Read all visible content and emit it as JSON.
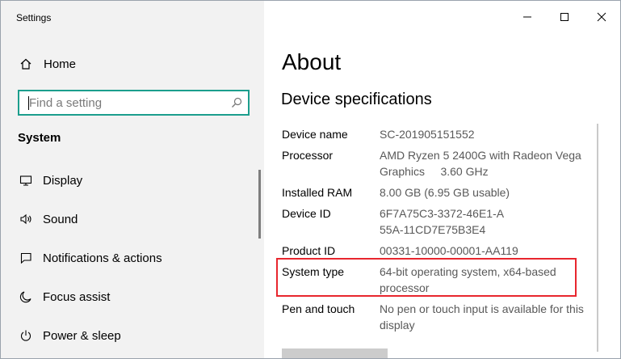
{
  "window": {
    "title": "Settings"
  },
  "sidebar": {
    "home_label": "Home",
    "search": {
      "placeholder": "Find a setting"
    },
    "section_title": "System",
    "items": [
      {
        "label": "Display",
        "icon": "display-icon"
      },
      {
        "label": "Sound",
        "icon": "speaker-icon"
      },
      {
        "label": "Notifications & actions",
        "icon": "notifications-icon"
      },
      {
        "label": "Focus assist",
        "icon": "moon-icon"
      },
      {
        "label": "Power & sleep",
        "icon": "power-icon"
      }
    ]
  },
  "content": {
    "title": "About",
    "subtitle": "Device specifications",
    "specs": [
      {
        "key": "Device name",
        "value": "SC-201905151552"
      },
      {
        "key": "Processor",
        "value": "AMD Ryzen 5 2400G with Radeon Vega Graphics     3.60 GHz"
      },
      {
        "key": "Installed RAM",
        "value": "8.00 GB (6.95 GB usable)"
      },
      {
        "key": "Device ID",
        "value": "6F7A75C3-3372-46E1-A55A-11CD7E75B3E4"
      },
      {
        "key": "Product ID",
        "value": "00331-10000-00001-AA119"
      },
      {
        "key": "System type",
        "value": "64-bit operating system, x64-based processor"
      },
      {
        "key": "Pen and touch",
        "value": "No pen or touch input is available for this display"
      }
    ],
    "highlighted_spec": "System type"
  },
  "colors": {
    "sidebar_bg": "#f2f2f2",
    "search_border": "#1c9e8d",
    "highlight_border": "#e8262e",
    "value_text": "#595959"
  }
}
